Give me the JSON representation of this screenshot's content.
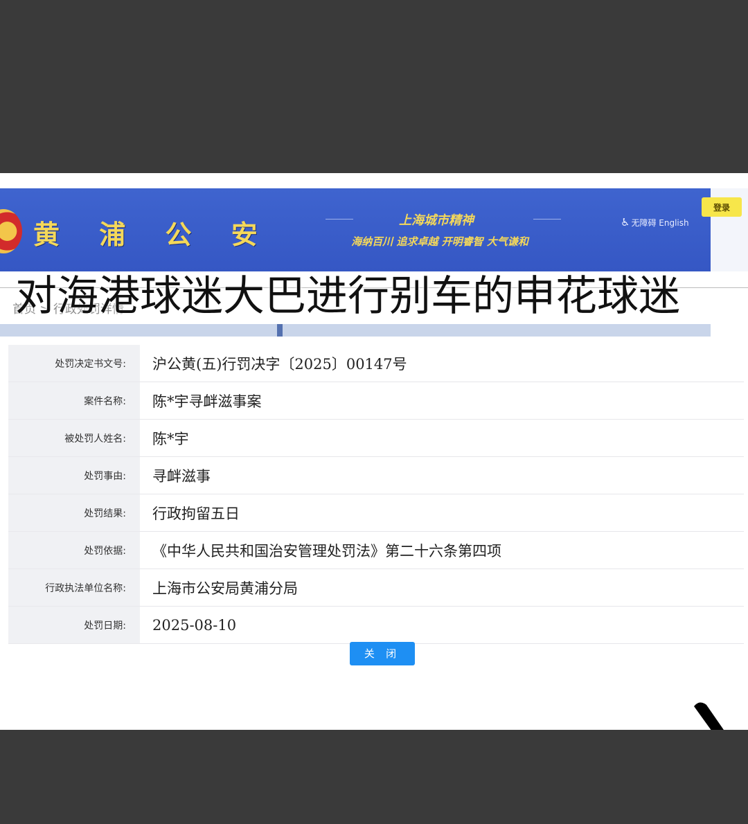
{
  "header": {
    "site_title": "黄 浦 公 安",
    "spirit_title": "上海城市精神",
    "spirit_motto": "海纳百川 追求卓越 开明睿智 大气谦和",
    "accessibility_label": "无障碍",
    "english_link": "English",
    "login_label": "登录"
  },
  "breadcrumb": "首页 > 行政处罚详情",
  "overlay_caption": "对海港球迷大巴进行别车的申花球迷",
  "details": [
    {
      "label": "处罚决定书文号:",
      "value": "沪公黄(五)行罚决字〔2025〕00147号"
    },
    {
      "label": "案件名称:",
      "value": "陈*宇寻衅滋事案"
    },
    {
      "label": "被处罚人姓名:",
      "value": "陈*宇"
    },
    {
      "label": "处罚事由:",
      "value": "寻衅滋事"
    },
    {
      "label": "处罚结果:",
      "value": "行政拘留五日"
    },
    {
      "label": "处罚依据:",
      "value": "《中华人民共和国治安管理处罚法》第二十六条第四项"
    },
    {
      "label": "行政执法单位名称:",
      "value": "上海市公安局黄浦分局"
    },
    {
      "label": "处罚日期:",
      "value": "2025-08-10"
    }
  ],
  "close_label": "关 闭",
  "icons": {
    "emblem": "police-emblem-icon",
    "accessibility": "wheelchair-icon",
    "cursor": "cursor-icon"
  },
  "colors": {
    "banner": "#3f64cf",
    "title_gold": "#f4d85a",
    "login_yellow": "#f7e64a",
    "close_blue": "#1e8ff3",
    "label_bg": "#f0f1f4"
  }
}
